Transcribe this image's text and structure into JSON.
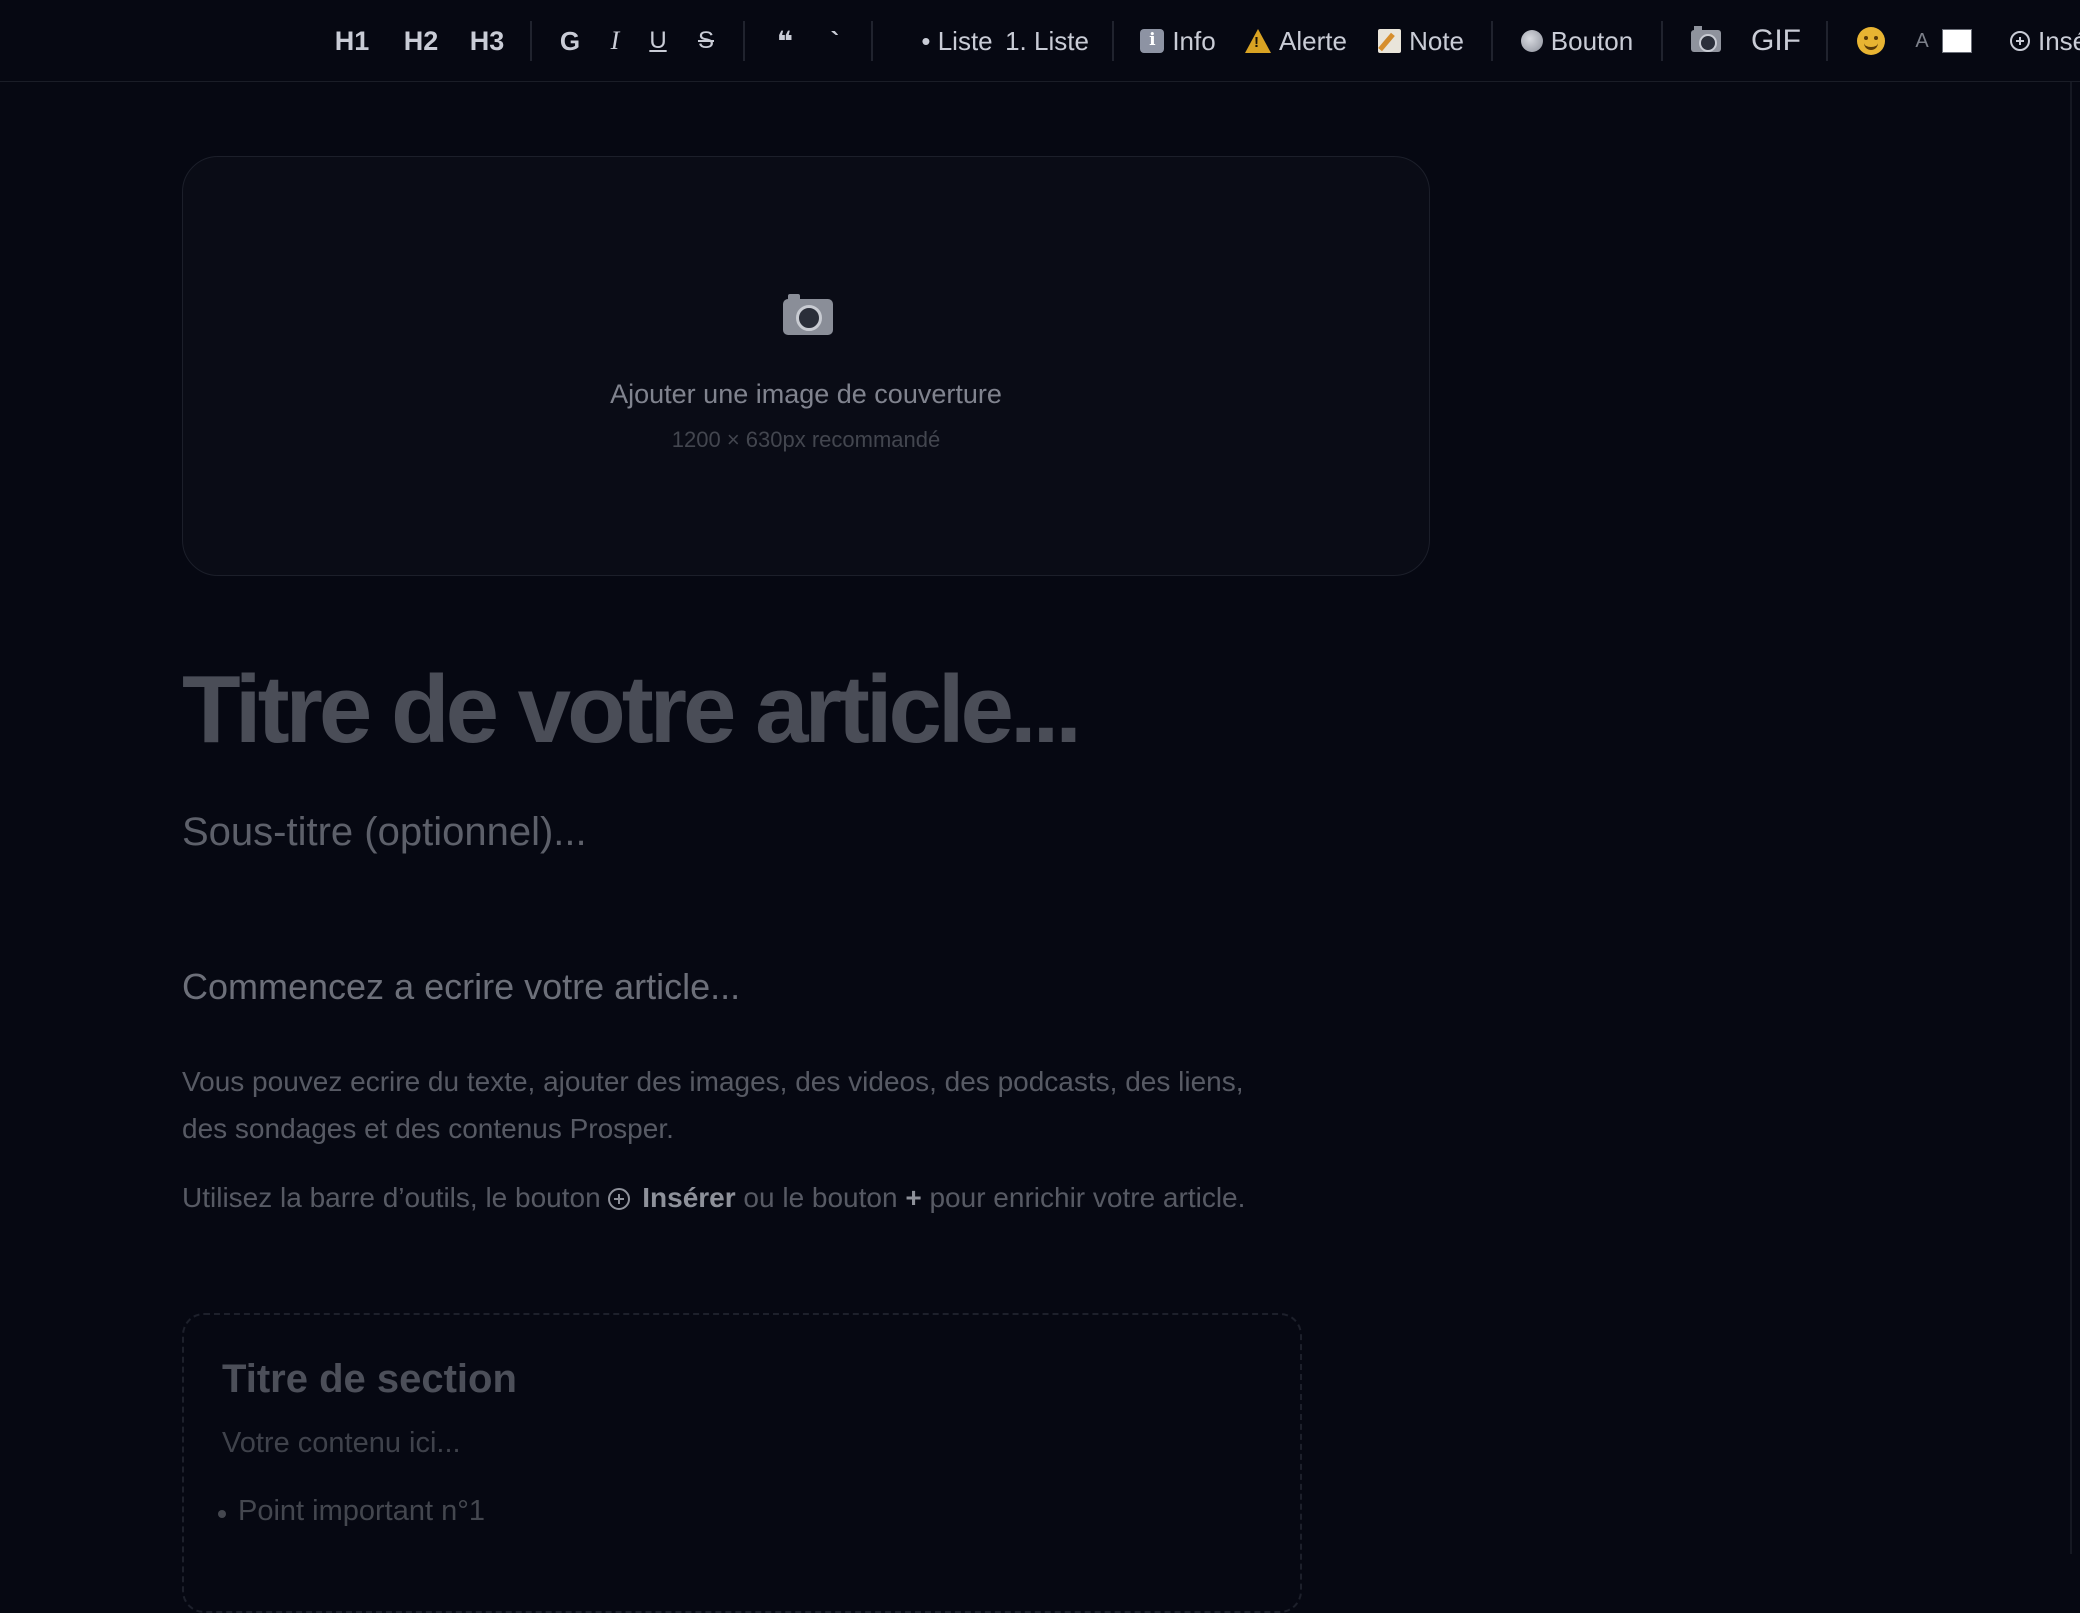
{
  "toolbar": {
    "h1": "H1",
    "h2": "H2",
    "h3": "H3",
    "bold": "G",
    "italic": "I",
    "underline": "U",
    "strike": "S",
    "quote": "❝",
    "code": "`",
    "bullet_list": "• Liste",
    "ordered_list": "1. Liste",
    "info": "Info",
    "alert": "Alerte",
    "note": "Note",
    "button": "Bouton",
    "gif": "GIF",
    "text_color_letter": "A",
    "insert": "Insé"
  },
  "cover": {
    "title": "Ajouter une image de couverture",
    "hint": "1200 × 630px recommandé"
  },
  "article": {
    "title_placeholder": "Titre de votre article...",
    "subtitle_placeholder": "Sous-titre (optionnel)...",
    "body_heading": "Commencez a ecrire votre article...",
    "paragraph1": "Vous pouvez ecrire du texte, ajouter des images, des videos, des podcasts, des liens, des sondages et des contenus Prosper.",
    "paragraph2_a": "Utilisez la barre d’outils, le bouton ",
    "paragraph2_insert": "Insérer",
    "paragraph2_b": " ou le bouton ",
    "paragraph2_plus": "+",
    "paragraph2_c": " pour enrichir votre article."
  },
  "section": {
    "title": "Titre de section",
    "content": "Votre contenu ici...",
    "bullet": "Point important n°1"
  },
  "colors": {
    "background": "#060812",
    "accent_text": "#c9ccd6",
    "swatch": "#ffffff"
  }
}
